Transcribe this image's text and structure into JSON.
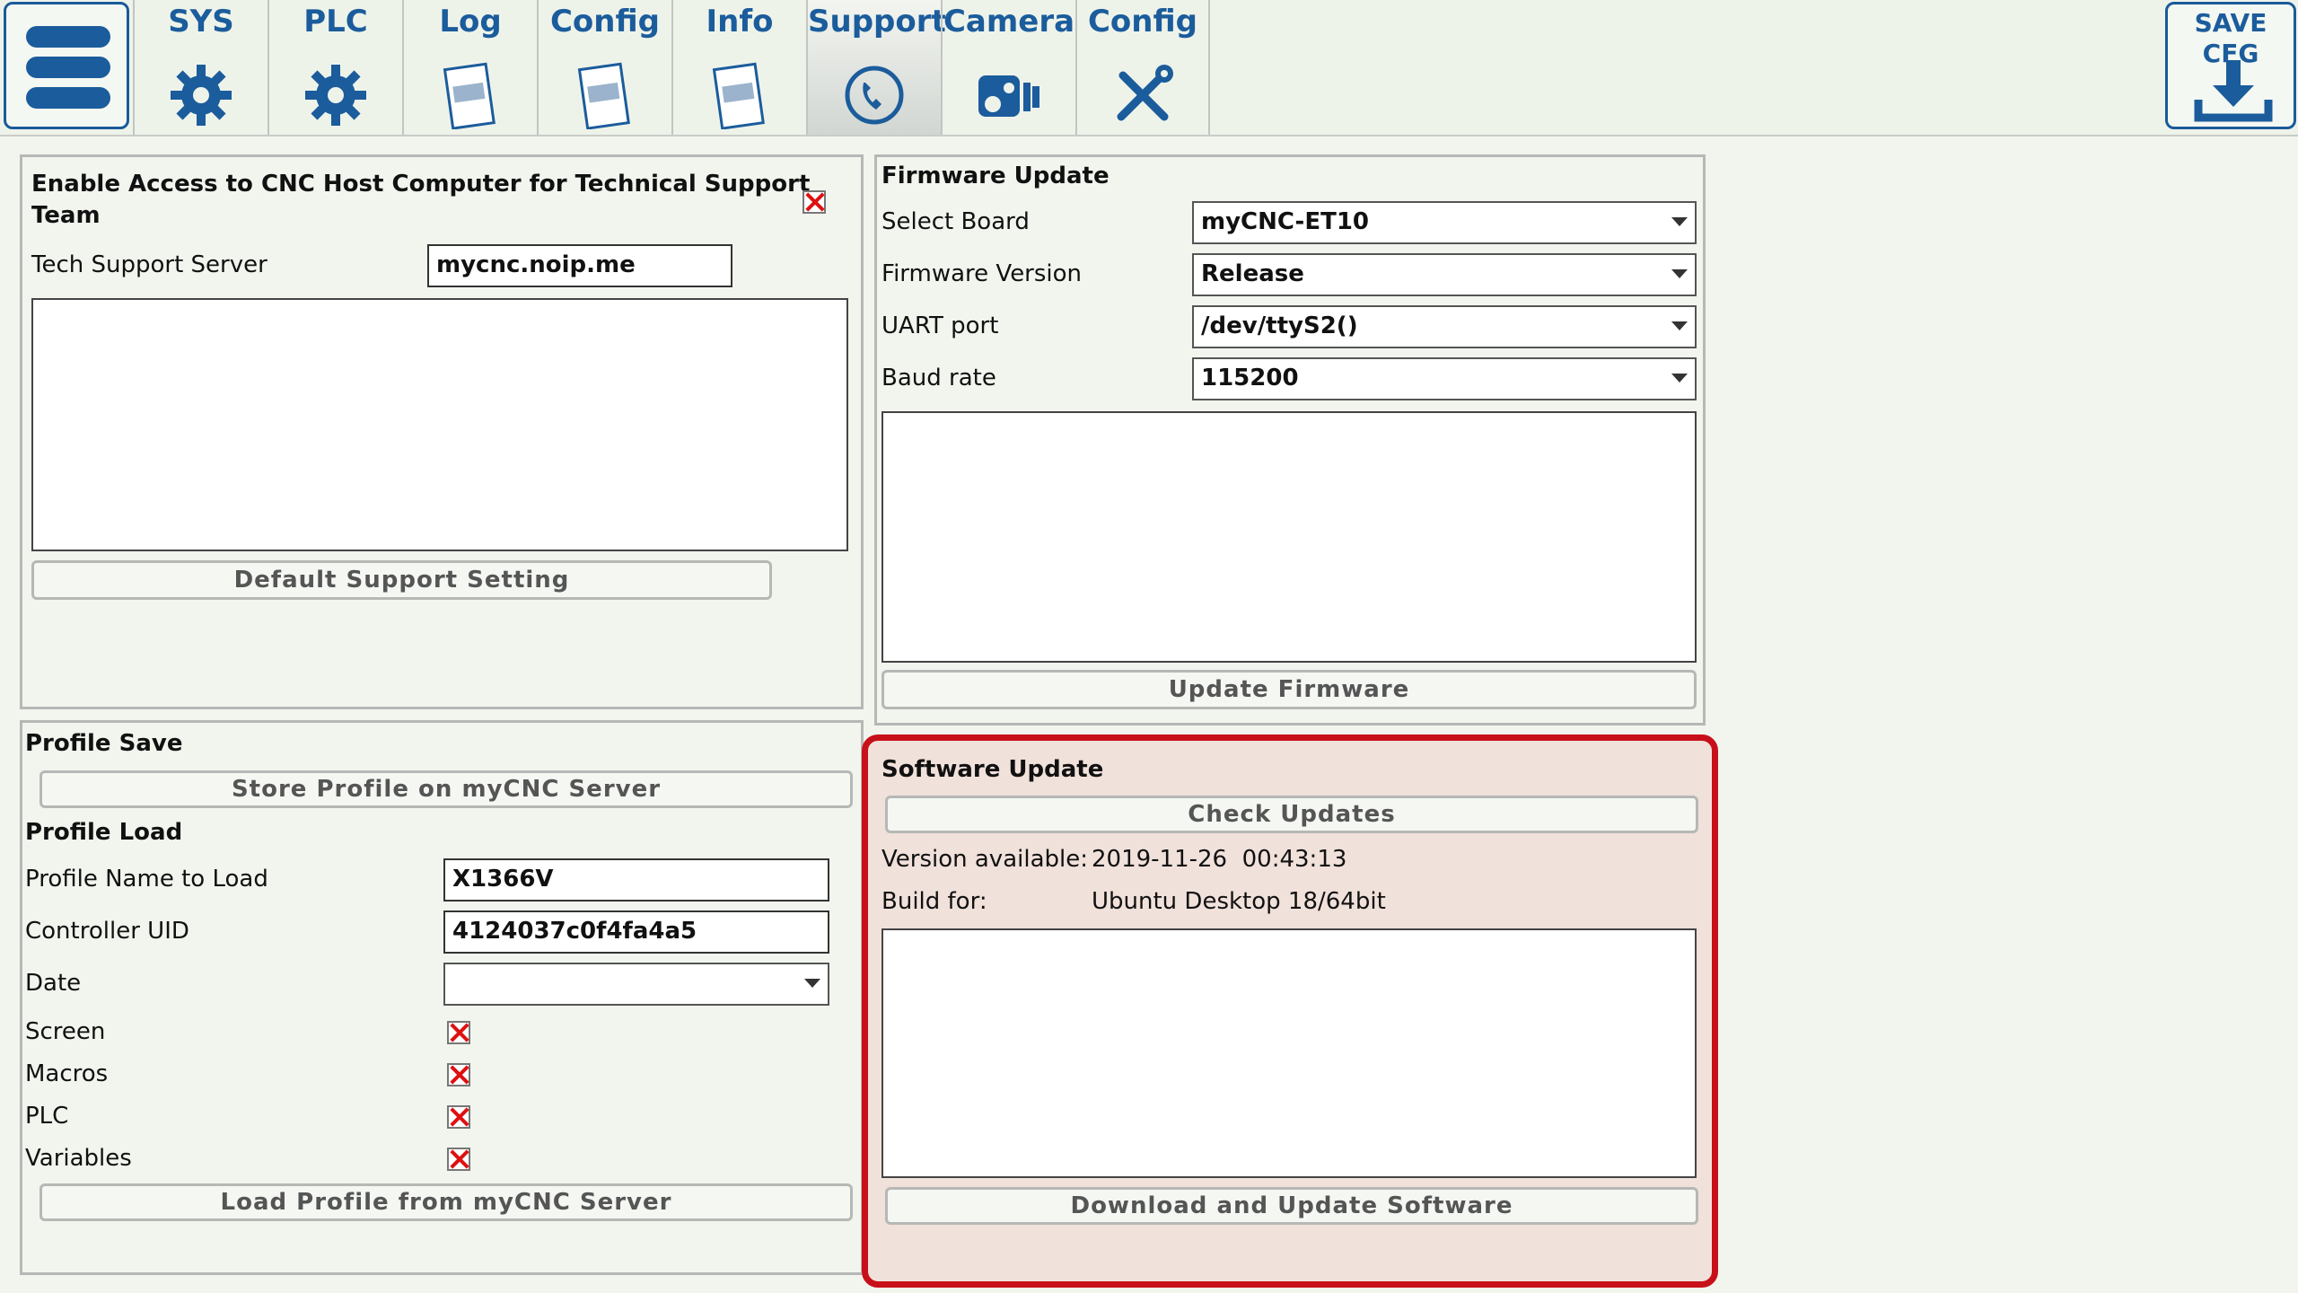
{
  "top_tabs": [
    {
      "label": "SYS",
      "icon": "gear-icon"
    },
    {
      "label": "PLC",
      "icon": "gear-icon"
    },
    {
      "label": "Log",
      "icon": "document-icon"
    },
    {
      "label": "Config",
      "icon": "document-icon"
    },
    {
      "label": "Info",
      "icon": "document-icon"
    },
    {
      "label": "Support",
      "icon": "phone-icon",
      "active": true
    },
    {
      "label": "Camera",
      "icon": "camera-icon"
    },
    {
      "label": "Config",
      "icon": "tools-icon"
    }
  ],
  "save_button": {
    "line1": "SAVE",
    "line2": "CFG",
    "icon": "download-icon"
  },
  "support_access": {
    "title_line1": "Enable Access to CNC Host Computer for Technical Support",
    "title_line2": "Team",
    "enabled": false,
    "server_label": "Tech Support Server",
    "server_value": "mycnc.noip.me",
    "default_button": "Default Support Setting"
  },
  "firmware": {
    "title": "Firmware Update",
    "rows": [
      {
        "label": "Select Board",
        "value": "myCNC-ET10"
      },
      {
        "label": "Firmware Version",
        "value": "Release"
      },
      {
        "label": "UART port",
        "value": "/dev/ttyS2()"
      },
      {
        "label": "Baud rate",
        "value": "115200"
      }
    ],
    "update_button": "Update Firmware"
  },
  "profile": {
    "save_title": "Profile Save",
    "store_button": "Store Profile on myCNC Server",
    "load_title": "Profile Load",
    "name_label": "Profile Name to Load",
    "name_value": "X1366V",
    "uid_label": "Controller UID",
    "uid_value": "4124037c0f4fa4a5",
    "date_label": "Date",
    "date_value": "",
    "checkboxes": [
      {
        "label": "Screen",
        "checked": true
      },
      {
        "label": "Macros",
        "checked": true
      },
      {
        "label": "PLC",
        "checked": true
      },
      {
        "label": "Variables",
        "checked": true
      }
    ],
    "load_button": "Load Profile from myCNC Server"
  },
  "software": {
    "title": "Software Update",
    "check_button": "Check Updates",
    "version_label": "Version available:",
    "version_value": "2019-11-26  00:43:13",
    "build_label": "Build for:",
    "build_value": "Ubuntu Desktop 18/64bit",
    "download_button": "Download and Update Software"
  },
  "colors": {
    "accent": "#1b5c9c",
    "highlight": "#c8101a",
    "checkbox_x": "#dd1111"
  }
}
